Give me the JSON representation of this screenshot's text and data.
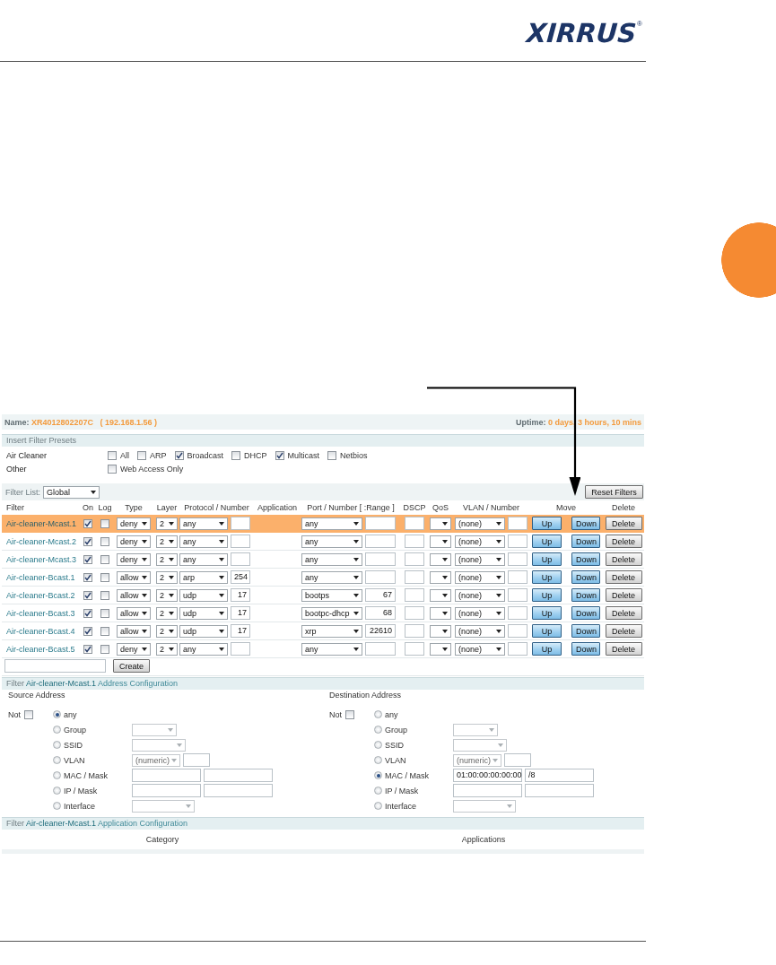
{
  "logo": {
    "text": "XIRRUS",
    "mark": "®"
  },
  "device": {
    "name_label": "Name:",
    "name": "XR4012802207C",
    "ip": "( 192.168.1.56 )",
    "uptime_label": "Uptime:",
    "uptime": "0 days, 3 hours, 10 mins"
  },
  "presets": {
    "title": "Insert Filter Presets",
    "groups": [
      {
        "label": "Air Cleaner",
        "options": [
          {
            "label": "All",
            "checked": false
          },
          {
            "label": "ARP",
            "checked": false
          },
          {
            "label": "Broadcast",
            "checked": true
          },
          {
            "label": "DHCP",
            "checked": false
          },
          {
            "label": "Multicast",
            "checked": true
          },
          {
            "label": "Netbios",
            "checked": false
          }
        ]
      },
      {
        "label": "Other",
        "options": [
          {
            "label": "Web Access Only",
            "checked": false
          }
        ]
      }
    ]
  },
  "filter_list": {
    "label": "Filter List:",
    "value": "Global",
    "reset_button": "Reset Filters"
  },
  "columns": [
    "Filter",
    "On",
    "Log",
    "Type",
    "Layer",
    "Protocol / Number",
    "Application",
    "Port / Number [ :Range ]",
    "DSCP",
    "QoS",
    "VLAN / Number",
    "Move",
    "Delete"
  ],
  "rows": [
    {
      "filter": "Air-cleaner-Mcast.1",
      "selected": true,
      "on": true,
      "log": false,
      "type": "deny",
      "layer": "2",
      "protocol": "any",
      "port": "any",
      "vlan": "(none)",
      "up": "Up",
      "down": "Down",
      "delete": "Delete"
    },
    {
      "filter": "Air-cleaner-Mcast.2",
      "selected": false,
      "on": true,
      "log": false,
      "type": "deny",
      "layer": "2",
      "protocol": "any",
      "port": "any",
      "vlan": "(none)",
      "up": "Up",
      "down": "Down",
      "delete": "Delete"
    },
    {
      "filter": "Air-cleaner-Mcast.3",
      "selected": false,
      "on": true,
      "log": false,
      "type": "deny",
      "layer": "2",
      "protocol": "any",
      "port": "any",
      "vlan": "(none)",
      "up": "Up",
      "down": "Down",
      "delete": "Delete"
    },
    {
      "filter": "Air-cleaner-Bcast.1",
      "selected": false,
      "on": true,
      "log": false,
      "type": "allow",
      "layer": "2",
      "protocol": "arp",
      "protocol_number": "254",
      "port": "any",
      "vlan": "(none)",
      "up": "Up",
      "down": "Down",
      "delete": "Delete"
    },
    {
      "filter": "Air-cleaner-Bcast.2",
      "selected": false,
      "on": true,
      "log": false,
      "type": "allow",
      "layer": "2",
      "protocol": "udp",
      "protocol_number": "17",
      "port": "bootps",
      "port_range": "67",
      "vlan": "(none)",
      "up": "Up",
      "down": "Down",
      "delete": "Delete"
    },
    {
      "filter": "Air-cleaner-Bcast.3",
      "selected": false,
      "on": true,
      "log": false,
      "type": "allow",
      "layer": "2",
      "protocol": "udp",
      "protocol_number": "17",
      "port": "bootpc-dhcp",
      "port_range": "68",
      "vlan": "(none)",
      "up": "Up",
      "down": "Down",
      "delete": "Delete"
    },
    {
      "filter": "Air-cleaner-Bcast.4",
      "selected": false,
      "on": true,
      "log": false,
      "type": "allow",
      "layer": "2",
      "protocol": "udp",
      "protocol_number": "17",
      "port": "xrp",
      "port_range": "22610",
      "vlan": "(none)",
      "up": "Up",
      "down": "Down",
      "delete": "Delete"
    },
    {
      "filter": "Air-cleaner-Bcast.5",
      "selected": false,
      "on": true,
      "log": false,
      "type": "deny",
      "layer": "2",
      "protocol": "any",
      "port": "any",
      "vlan": "(none)",
      "up": "Up",
      "down": "Down",
      "delete": "Delete"
    }
  ],
  "create_button": "Create",
  "address": {
    "title": {
      "prefix": "Filter",
      "name": "Air-cleaner-Mcast.1",
      "suffix": "Address Configuration"
    },
    "sides": [
      {
        "heading": "Source Address",
        "not_label": "Not",
        "not_checked": false,
        "options": [
          {
            "kind": "plain",
            "label": "any",
            "selected": true
          },
          {
            "kind": "select",
            "label": "Group",
            "selected": false
          },
          {
            "kind": "select",
            "label": "SSID",
            "selected": false
          },
          {
            "kind": "select_input",
            "label": "VLAN",
            "selected": false,
            "value": "(numeric)"
          },
          {
            "kind": "pair",
            "label": "MAC / Mask",
            "selected": false
          },
          {
            "kind": "pair",
            "label": "IP / Mask",
            "selected": false
          },
          {
            "kind": "select",
            "label": "Interface",
            "selected": false
          }
        ]
      },
      {
        "heading": "Destination Address",
        "not_label": "Not",
        "not_checked": false,
        "options": [
          {
            "kind": "plain",
            "label": "any",
            "selected": false
          },
          {
            "kind": "select",
            "label": "Group",
            "selected": false
          },
          {
            "kind": "select",
            "label": "SSID",
            "selected": false
          },
          {
            "kind": "select_input",
            "label": "VLAN",
            "selected": false,
            "value": "(numeric)"
          },
          {
            "kind": "pair",
            "label": "MAC / Mask",
            "selected": true,
            "value": "01:00:00:00:00:00",
            "mask": "/8"
          },
          {
            "kind": "pair",
            "label": "IP / Mask",
            "selected": false
          },
          {
            "kind": "select",
            "label": "Interface",
            "selected": false
          }
        ]
      }
    ]
  },
  "application": {
    "title": {
      "prefix": "Filter",
      "name": "Air-cleaner-Mcast.1",
      "suffix": "Application Configuration"
    },
    "columns": [
      "Category",
      "Applications"
    ]
  }
}
